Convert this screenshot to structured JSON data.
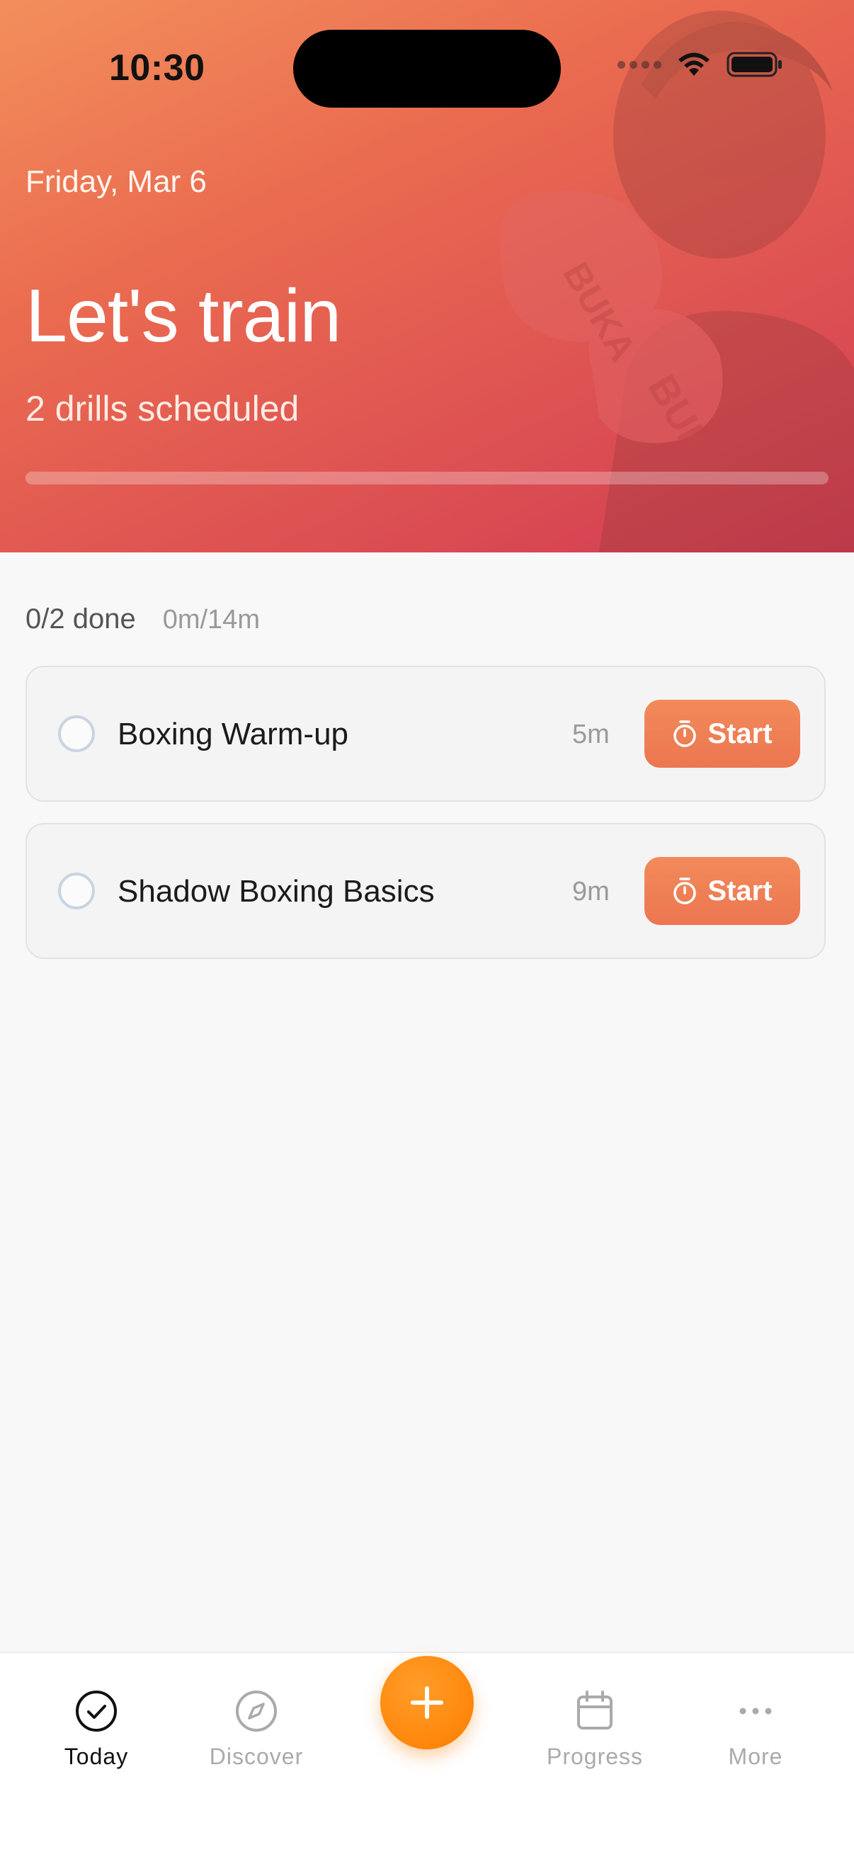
{
  "status_bar": {
    "time": "10:30"
  },
  "header": {
    "date": "Friday, Mar 6",
    "title": "Let's train",
    "subtitle": "2 drills scheduled",
    "progress_fraction": 0
  },
  "summary": {
    "done": "0/2 done",
    "time": "0m/14m"
  },
  "drills": [
    {
      "name": "Boxing Warm-up",
      "duration": "5m",
      "button": "Start"
    },
    {
      "name": "Shadow Boxing Basics",
      "duration": "9m",
      "button": "Start"
    }
  ],
  "tabs": [
    {
      "label": "Today",
      "icon": "check-circle-icon",
      "active": true
    },
    {
      "label": "Discover",
      "icon": "compass-icon",
      "active": false
    },
    {
      "label": "Progress",
      "icon": "calendar-icon",
      "active": false
    },
    {
      "label": "More",
      "icon": "more-dots-icon",
      "active": false
    }
  ],
  "fab": {
    "icon": "plus-icon"
  },
  "colors": {
    "accent": "#ff8a0f",
    "start_button": "#ef7d55",
    "header_gradient_start": "#f38f5c",
    "header_gradient_end": "#d13b52"
  }
}
